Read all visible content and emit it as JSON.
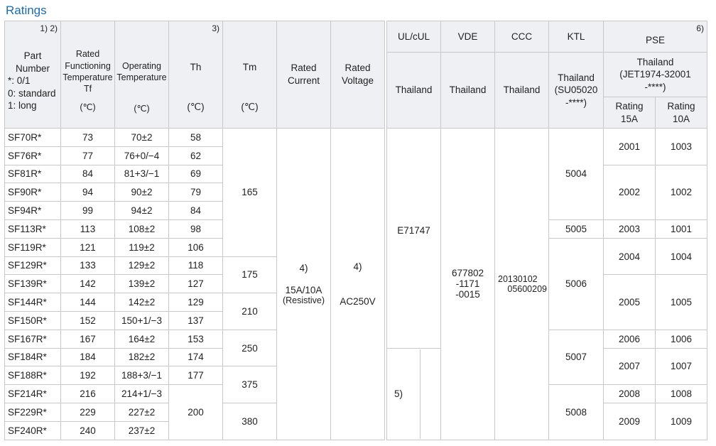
{
  "heading": "Ratings",
  "notes": {
    "n12": "1) 2)",
    "n3": "3)",
    "n6": "6)"
  },
  "head": {
    "part_number": [
      "Part",
      "Number",
      "*: 0/1",
      "0: standard",
      "1: long"
    ],
    "rated_func": [
      "Rated",
      "Functioning",
      "Temperature",
      "Tf"
    ],
    "operating": [
      "Operating",
      "Temperature"
    ],
    "th": "Th",
    "tm": "Tm",
    "rated_current": [
      "Rated",
      "Current"
    ],
    "rated_voltage": [
      "Rated",
      "Voltage"
    ],
    "unit": "(℃)",
    "ul": "UL/cUL",
    "vde": "VDE",
    "ccc": "CCC",
    "ktl": "KTL",
    "pse": "PSE",
    "thailand": "Thailand",
    "ktl_code": [
      "(SU05020",
      "-****)"
    ],
    "pse_thailand": [
      "Thailand",
      "(JET1974-32001",
      "-****)"
    ],
    "rating15": [
      "Rating",
      "15A"
    ],
    "rating10": [
      "Rating",
      "10A"
    ]
  },
  "rows": [
    {
      "part": "SF70R*",
      "tf": "73",
      "op": "70±2",
      "th": "58"
    },
    {
      "part": "SF76R*",
      "tf": "77",
      "op": "76+0/−4",
      "th": "62"
    },
    {
      "part": "SF81R*",
      "tf": "84",
      "op": "81+3/−1",
      "th": "69"
    },
    {
      "part": "SF90R*",
      "tf": "94",
      "op": "90±2",
      "th": "79"
    },
    {
      "part": "SF94R*",
      "tf": "99",
      "op": "94±2",
      "th": "84"
    },
    {
      "part": "SF113R*",
      "tf": "113",
      "op": "108±2",
      "th": "98"
    },
    {
      "part": "SF119R*",
      "tf": "121",
      "op": "119±2",
      "th": "106"
    },
    {
      "part": "SF129R*",
      "tf": "133",
      "op": "129±2",
      "th": "118"
    },
    {
      "part": "SF139R*",
      "tf": "142",
      "op": "139±2",
      "th": "127"
    },
    {
      "part": "SF144R*",
      "tf": "144",
      "op": "142±2",
      "th": "129"
    },
    {
      "part": "SF150R*",
      "tf": "152",
      "op": "150+1/−3",
      "th": "137"
    },
    {
      "part": "SF167R*",
      "tf": "167",
      "op": "164±2",
      "th": "153"
    },
    {
      "part": "SF184R*",
      "tf": "184",
      "op": "182±2",
      "th": "174"
    },
    {
      "part": "SF188R*",
      "tf": "192",
      "op": "188+3/−1",
      "th": "177"
    },
    {
      "part": "SF214R*",
      "tf": "216",
      "op": "214+1/−3",
      "th": ""
    },
    {
      "part": "SF229R*",
      "tf": "229",
      "op": "227±2",
      "th": ""
    },
    {
      "part": "SF240R*",
      "tf": "240",
      "op": "237±2",
      "th": ""
    }
  ],
  "th_merged": "200",
  "tm": [
    "165",
    "175",
    "210",
    "250",
    "375",
    "380"
  ],
  "rated_current": {
    "note": "4)",
    "value": "15A/10A",
    "sub": "(Resistive)"
  },
  "rated_voltage": {
    "note": "4)",
    "value": "AC250V"
  },
  "ul": {
    "value": "E71747",
    "note": "5)"
  },
  "vde": [
    "677802",
    "-1171",
    "-0015"
  ],
  "ccc": [
    "20130102",
    "05600209"
  ],
  "ktl": [
    "5004",
    "5005",
    "5006",
    "5007",
    "5008"
  ],
  "pse15": [
    "2001",
    "2002",
    "2003",
    "2004",
    "2005",
    "2006",
    "2007",
    "2008",
    "2009"
  ],
  "pse10": [
    "1003",
    "1002",
    "1001",
    "1004",
    "1005",
    "1006",
    "1007",
    "1008",
    "1009"
  ]
}
